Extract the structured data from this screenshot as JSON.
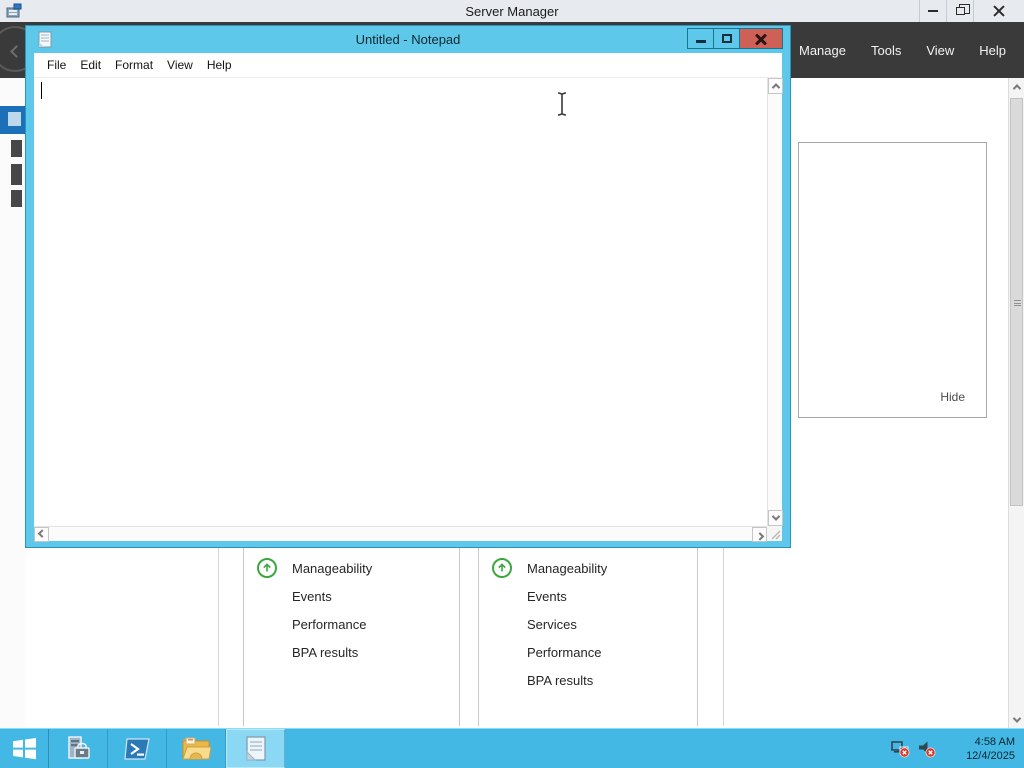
{
  "server_manager": {
    "window_title": "Server Manager",
    "header_menu": [
      "Manage",
      "Tools",
      "View",
      "Help"
    ],
    "panel": {
      "hide_label": "Hide"
    },
    "tiles": [
      {
        "rows": [
          "Manageability",
          "Events",
          "Performance",
          "BPA results"
        ]
      },
      {
        "rows": [
          "Manageability",
          "Events",
          "Services",
          "Performance",
          "BPA results"
        ]
      }
    ]
  },
  "notepad": {
    "window_title": "Untitled - Notepad",
    "menu": [
      "File",
      "Edit",
      "Format",
      "View",
      "Help"
    ],
    "content": ""
  },
  "taskbar": {
    "clock": {
      "time": "4:58 AM",
      "date": "12/4/2025"
    }
  },
  "colors": {
    "accent_cyan": "#5ec8ea",
    "taskbar_cyan": "#44b8e4",
    "header_dark": "#3a3a3a",
    "selected_blue": "#1c70b8",
    "close_red": "#cf6055",
    "status_green": "#3ba83e"
  }
}
